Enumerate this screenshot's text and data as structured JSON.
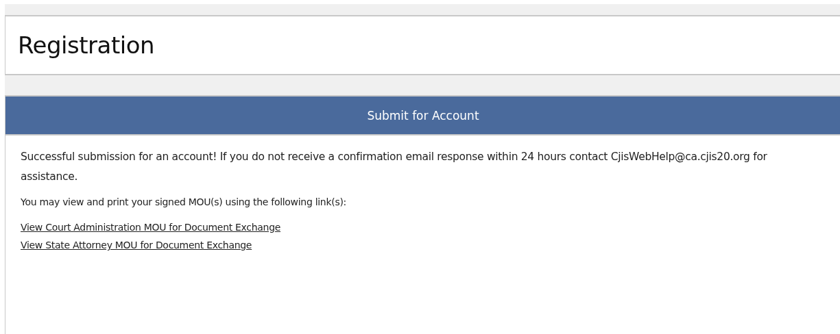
{
  "page": {
    "title": "Registration"
  },
  "panel": {
    "title": "Submit for Account",
    "message": "Successful submission for an account! If you do not receive a confirmation email response within 24 hours contact CjisWebHelp@ca.cjis20.org for assistance.",
    "instruction": "You may view and print your signed MOU(s) using the following link(s):",
    "links": [
      "View Court Administration MOU for Document Exchange",
      "View State Attorney MOU for Document Exchange"
    ]
  }
}
